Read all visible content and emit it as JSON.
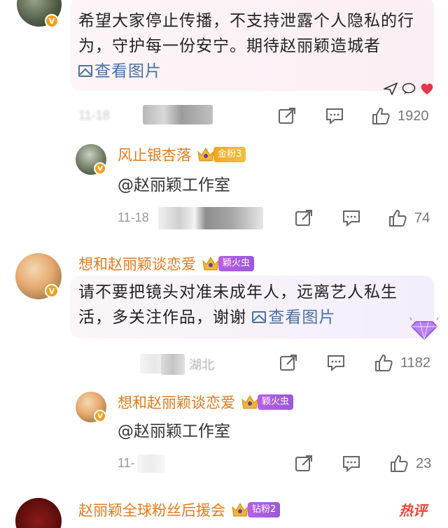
{
  "comments": [
    {
      "text": "希望大家停止传播，不支持泄露个人隐私的行为，守护每一份安宁。期待赵丽颖造城者",
      "view_pic": "查看图片",
      "time": "11-18",
      "like_count": "1920",
      "reply": {
        "username": "风止银杏落",
        "fan_badge": "金粉3",
        "text": "@赵丽颖工作室",
        "time": "11-18",
        "like_count": "74"
      }
    },
    {
      "username": "想和赵丽颖谈恋爱",
      "fan_badge": "颖火虫",
      "text": "请不要把镜头对准未成年人，远离艺人私生活，多关注作品，谢谢",
      "view_pic": "查看图片",
      "location": "湖北",
      "like_count": "1182",
      "reply": {
        "username": "想和赵丽颖谈恋爱",
        "fan_badge": "颖火虫",
        "text": "@赵丽颖工作室",
        "time": "11-",
        "like_count": "23"
      }
    },
    {
      "username": "赵丽颖全球粉丝后援会",
      "fan_badge": "钻粉2",
      "hot_label": "热评"
    }
  ],
  "icons": {
    "verified": "verified-v-icon",
    "share": "share-icon",
    "comment": "comment-icon",
    "like": "thumbs-up-icon",
    "crown": "crown-icon",
    "diamond": "diamond-icon"
  },
  "colors": {
    "username": "#e07a1f",
    "link": "#4a6fa5",
    "bubble_pink": "#fbf1f6",
    "bubble_lavender": "#f4eefb",
    "meta": "#999999"
  }
}
